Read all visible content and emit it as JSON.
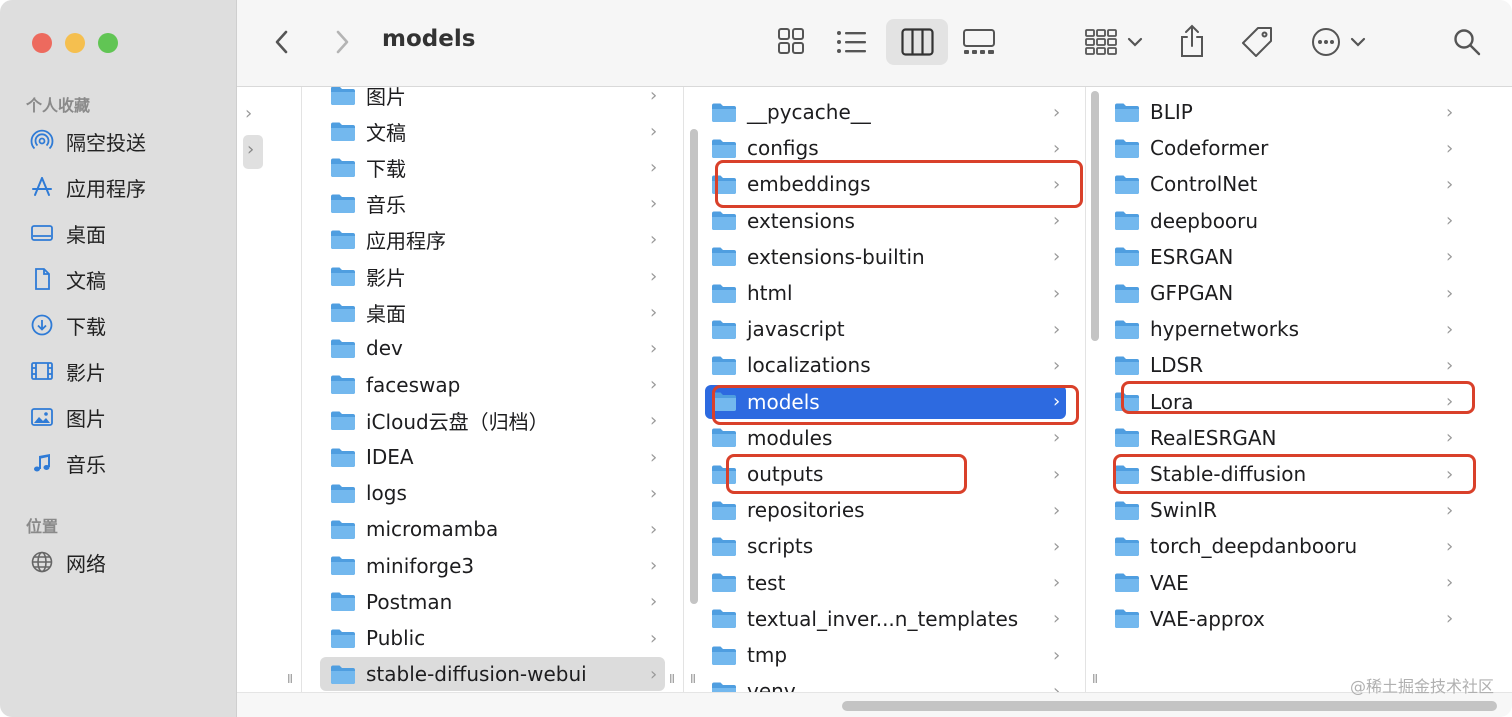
{
  "window": {
    "title": "models"
  },
  "sidebar": {
    "favorites_heading": "个人收藏",
    "favorites": [
      {
        "label": "隔空投送",
        "icon": "airdrop-icon"
      },
      {
        "label": "应用程序",
        "icon": "applications-icon"
      },
      {
        "label": "桌面",
        "icon": "desktop-icon"
      },
      {
        "label": "文稿",
        "icon": "document-icon"
      },
      {
        "label": "下载",
        "icon": "download-icon"
      },
      {
        "label": "影片",
        "icon": "movies-icon"
      },
      {
        "label": "图片",
        "icon": "pictures-icon"
      },
      {
        "label": "音乐",
        "icon": "music-icon"
      }
    ],
    "locations_heading": "位置",
    "locations": [
      {
        "label": "网络",
        "icon": "network-icon"
      }
    ]
  },
  "toolbar": {
    "back_icon": "chevron-left-icon",
    "forward_icon": "chevron-right-icon",
    "views": [
      "icon-view",
      "list-view",
      "column-view",
      "gallery-view"
    ],
    "active_view": "column-view"
  },
  "column1": {
    "items": [
      {
        "label": "图片"
      },
      {
        "label": "文稿"
      },
      {
        "label": "下载"
      },
      {
        "label": "音乐"
      },
      {
        "label": "应用程序"
      },
      {
        "label": "影片"
      },
      {
        "label": "桌面"
      },
      {
        "label": "dev"
      },
      {
        "label": "faceswap"
      },
      {
        "label": "iCloud云盘（归档）"
      },
      {
        "label": "IDEA"
      },
      {
        "label": "logs"
      },
      {
        "label": "micromamba"
      },
      {
        "label": "miniforge3"
      },
      {
        "label": "Postman"
      },
      {
        "label": "Public"
      },
      {
        "label": "stable-diffusion-webui"
      }
    ],
    "selected": "stable-diffusion-webui"
  },
  "column2": {
    "items": [
      {
        "label": "__pycache__"
      },
      {
        "label": "configs"
      },
      {
        "label": "embeddings"
      },
      {
        "label": "extensions"
      },
      {
        "label": "extensions-builtin"
      },
      {
        "label": "html"
      },
      {
        "label": "javascript"
      },
      {
        "label": "localizations"
      },
      {
        "label": "models"
      },
      {
        "label": "modules"
      },
      {
        "label": "outputs"
      },
      {
        "label": "repositories"
      },
      {
        "label": "scripts"
      },
      {
        "label": "test"
      },
      {
        "label": "textual_inver...n_templates"
      },
      {
        "label": "tmp"
      },
      {
        "label": "venv"
      }
    ],
    "selected": "models"
  },
  "column3": {
    "items": [
      {
        "label": "BLIP"
      },
      {
        "label": "Codeformer"
      },
      {
        "label": "ControlNet"
      },
      {
        "label": "deepbooru"
      },
      {
        "label": "ESRGAN"
      },
      {
        "label": "GFPGAN"
      },
      {
        "label": "hypernetworks"
      },
      {
        "label": "LDSR"
      },
      {
        "label": "Lora"
      },
      {
        "label": "RealESRGAN"
      },
      {
        "label": "Stable-diffusion"
      },
      {
        "label": "SwinIR"
      },
      {
        "label": "torch_deepdanbooru"
      },
      {
        "label": "VAE"
      },
      {
        "label": "VAE-approx"
      }
    ]
  },
  "annotations": {
    "highlighted": [
      "embeddings",
      "models",
      "outputs",
      "Lora",
      "Stable-diffusion"
    ],
    "color": "#d9402a"
  },
  "colors": {
    "selection_blue": "#2d6ae0",
    "folder_blue": "#5aa9e6"
  },
  "watermark": "@稀土掘金技术社区"
}
